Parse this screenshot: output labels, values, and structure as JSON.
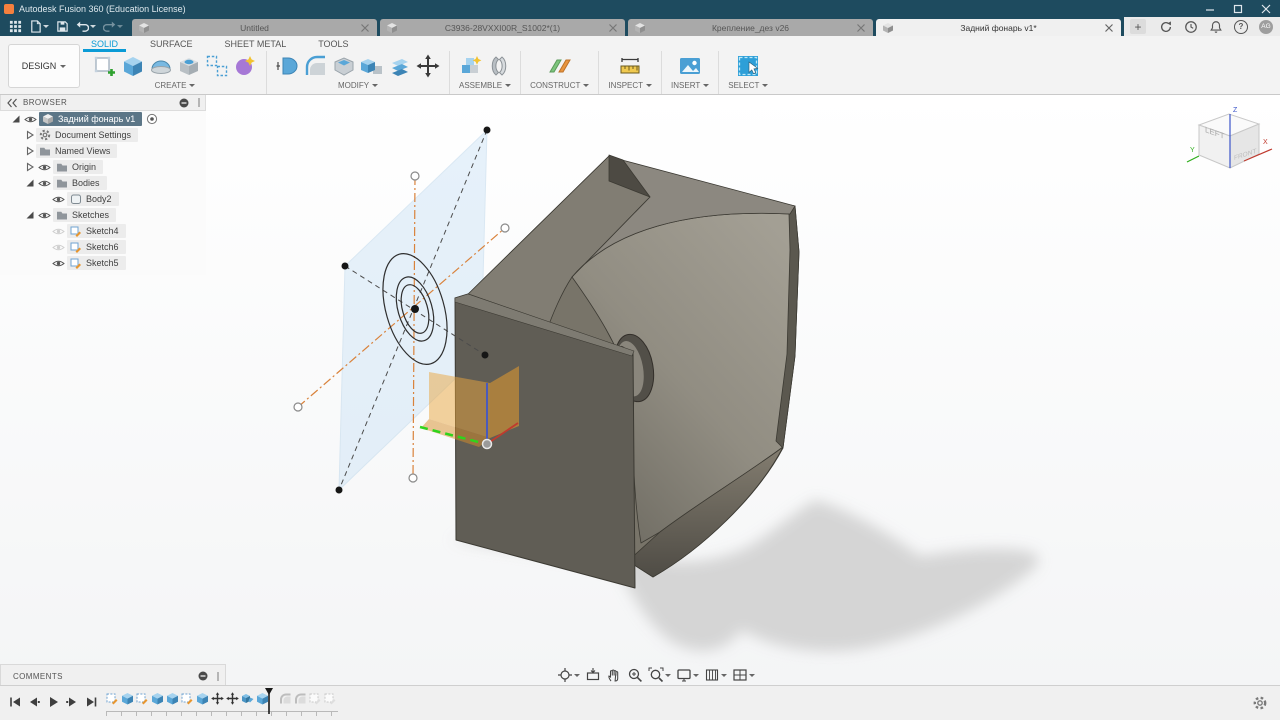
{
  "window": {
    "title": "Autodesk Fusion 360 (Education License)",
    "controls": [
      "minimize",
      "maximize",
      "close"
    ]
  },
  "quick_access": {
    "items": [
      "application-grid",
      "file-menu",
      "save",
      "undo",
      "redo"
    ]
  },
  "tabs": [
    {
      "label": "Untitled",
      "active": false
    },
    {
      "label": "C3936-28VXXI00R_S1002*(1)",
      "active": false
    },
    {
      "label": "Крепление_дез v26",
      "active": false
    },
    {
      "label": "Задний фонарь v1*",
      "active": true
    }
  ],
  "tabbar": {
    "new_tab_glyph": "+",
    "help_glyph": "?",
    "account_initials": "AG",
    "right_icons": [
      "sync",
      "recent",
      "notifications",
      "help",
      "account"
    ]
  },
  "ribbon": {
    "workspace": "DESIGN",
    "tabs": [
      {
        "label": "SOLID",
        "active": true
      },
      {
        "label": "SURFACE",
        "active": false
      },
      {
        "label": "SHEET METAL",
        "active": false
      },
      {
        "label": "TOOLS",
        "active": false
      }
    ],
    "groups": [
      {
        "label": "CREATE",
        "icons": [
          "create-sketch",
          "extrude",
          "revolve",
          "hole",
          "rectangular-pattern",
          "create-form"
        ]
      },
      {
        "label": "MODIFY",
        "icons": [
          "press-pull",
          "fillet",
          "shell",
          "combine",
          "offset-face",
          "move-copy"
        ]
      },
      {
        "label": "ASSEMBLE",
        "icons": [
          "new-component",
          "joint"
        ]
      },
      {
        "label": "CONSTRUCT",
        "icons": [
          "construction-plane"
        ]
      },
      {
        "label": "INSPECT",
        "icons": [
          "measure"
        ]
      },
      {
        "label": "INSERT",
        "icons": [
          "insert-image"
        ]
      },
      {
        "label": "SELECT",
        "icons": [
          "select"
        ]
      }
    ]
  },
  "browser": {
    "header": "BROWSER",
    "rows": [
      {
        "label": "Задний фонарь v1",
        "level": 0,
        "selected": true,
        "expander": "expanded",
        "eye": "visible",
        "icon": "component"
      },
      {
        "label": "Document Settings",
        "level": 1,
        "selected": false,
        "expander": "collapsed",
        "eye": "none",
        "icon": "gear"
      },
      {
        "label": "Named Views",
        "level": 1,
        "selected": false,
        "expander": "collapsed",
        "eye": "none",
        "icon": "folder"
      },
      {
        "label": "Origin",
        "level": 1,
        "selected": false,
        "expander": "collapsed",
        "eye": "visible",
        "icon": "folder"
      },
      {
        "label": "Bodies",
        "level": 1,
        "selected": false,
        "expander": "expanded",
        "eye": "visible",
        "icon": "folder"
      },
      {
        "label": "Body2",
        "level": 2,
        "selected": false,
        "expander": "none",
        "eye": "visible",
        "icon": "body"
      },
      {
        "label": "Sketches",
        "level": 1,
        "selected": false,
        "expander": "expanded",
        "eye": "visible",
        "icon": "folder"
      },
      {
        "label": "Sketch4",
        "level": 2,
        "selected": false,
        "expander": "none",
        "eye": "hidden",
        "icon": "sketch"
      },
      {
        "label": "Sketch6",
        "level": 2,
        "selected": false,
        "expander": "none",
        "eye": "hidden",
        "icon": "sketch"
      },
      {
        "label": "Sketch5",
        "level": 2,
        "selected": false,
        "expander": "none",
        "eye": "visible",
        "icon": "sketch"
      }
    ]
  },
  "comments": {
    "header": "COMMENTS"
  },
  "viewcube": {
    "left": "LEFT",
    "front": "FRONT",
    "x": "X",
    "y": "Y",
    "z": "Z"
  },
  "navbar": {
    "items": [
      "orbit",
      "look-at",
      "pan",
      "zoom",
      "window-zoom",
      "display-settings",
      "grid-display",
      "viewports"
    ]
  },
  "timeline": {
    "transport": [
      "go-to-start",
      "step-back",
      "play",
      "step-forward",
      "go-to-end"
    ],
    "features": [
      {
        "position": 1,
        "type": "sketch",
        "state": "computed"
      },
      {
        "position": 2,
        "type": "extrude",
        "state": "computed"
      },
      {
        "position": 3,
        "type": "sketch",
        "state": "computed"
      },
      {
        "position": 4,
        "type": "extrude",
        "state": "computed"
      },
      {
        "position": 5,
        "type": "extrude",
        "state": "computed"
      },
      {
        "position": 6,
        "type": "sketch",
        "state": "computed"
      },
      {
        "position": 7,
        "type": "extrude",
        "state": "computed"
      },
      {
        "position": 8,
        "type": "move",
        "state": "computed"
      },
      {
        "position": 9,
        "type": "move",
        "state": "computed"
      },
      {
        "position": 10,
        "type": "combine",
        "state": "computed"
      },
      {
        "position": 11,
        "type": "extrude",
        "state": "computed"
      },
      {
        "position": 12,
        "type": "fillet",
        "state": "after-playhead"
      },
      {
        "position": 13,
        "type": "fillet",
        "state": "after-playhead"
      },
      {
        "position": 14,
        "type": "sketch",
        "state": "after-playhead"
      },
      {
        "position": 15,
        "type": "sketch",
        "state": "after-playhead"
      }
    ]
  },
  "colors": {
    "accent_blue": "#0a9bd6",
    "titlebar": "#1e4b5f",
    "selection": "#5c7687",
    "construction_orange": "#d9823b",
    "highlight_orange": "#e8a33c",
    "axis_green": "#2fd41c",
    "axis_red": "#c03a2e",
    "axis_blue": "#4056c8",
    "sketch_plane": "#cfe5f7",
    "model_gray": "#77746b"
  }
}
